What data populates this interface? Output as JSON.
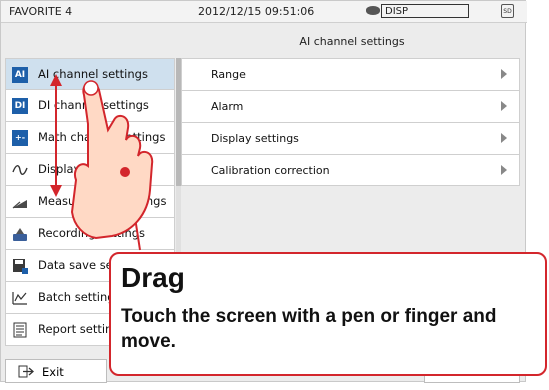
{
  "statusbar": {
    "favorite": "FAVORITE 4",
    "datetime": "2012/12/15 09:51:06",
    "disp": "DISP",
    "sd": "SD"
  },
  "title": "AI channel settings",
  "menu": [
    {
      "icon_text": "AI",
      "label": "AI channel settings"
    },
    {
      "icon_text": "DI",
      "label": "DI channel settings"
    },
    {
      "icon_text": "+-",
      "label": "Math channel settings"
    },
    {
      "icon_text": "~",
      "label": "Display settings"
    },
    {
      "icon_text": "",
      "label": "Measurement settings"
    },
    {
      "icon_text": "",
      "label": "Recording settings"
    },
    {
      "icon_text": "",
      "label": "Data save settings"
    },
    {
      "icon_text": "",
      "label": "Batch settings"
    },
    {
      "icon_text": "",
      "label": "Report settings"
    }
  ],
  "panel": [
    {
      "label": "Range"
    },
    {
      "label": "Alarm"
    },
    {
      "label": "Display settings"
    },
    {
      "label": "Calibration correction"
    }
  ],
  "exit_label": "Exit",
  "callout": {
    "heading": "Drag",
    "text": "Touch the screen with a pen or finger and move."
  },
  "colors": {
    "accent": "#1d5fa9",
    "selected": "#cfe0ee",
    "callout_border": "#d3262c",
    "hand": "#ffd9c5",
    "hand_outline": "#d3262c",
    "arrow": "#d3262c"
  },
  "icons": [
    "disk-icon",
    "sd-card-icon",
    "ai-icon",
    "di-icon",
    "math-icon",
    "wave-icon",
    "measurement-icon",
    "recording-icon",
    "save-icon",
    "batch-icon",
    "report-icon",
    "exit-icon",
    "chevron-right-icon",
    "hand-icon",
    "drag-arrow-icon"
  ]
}
